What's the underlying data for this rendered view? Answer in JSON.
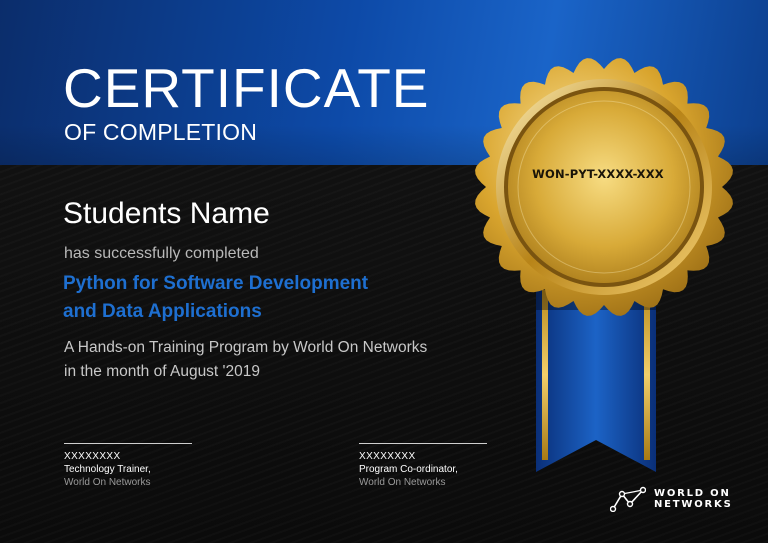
{
  "certificate": {
    "title": "CERTIFICATE",
    "subtitle": "OF COMPLETION",
    "student_name": "Students Name",
    "completed_text": "has successfully completed",
    "course_title_lines": [
      "Python for Software Development",
      "and Data Applications"
    ],
    "program_lines": [
      "A Hands-on Training Program by World On Networks",
      "in the month of August '2019"
    ]
  },
  "medal": {
    "certificate_id": "WON-PYT-XXXX-XXX"
  },
  "signatures": [
    {
      "name": "XXXXXXXX",
      "role": "Technology Trainer,",
      "org": "World On Networks"
    },
    {
      "name": "XXXXXXXX",
      "role": "Program Co-ordinator,",
      "org": "World On Networks"
    }
  ],
  "logo": {
    "lines": [
      "WORLD ON",
      "NETWORKS"
    ]
  },
  "colors": {
    "band_blue": "#0d4aa8",
    "course_blue": "#1e6fd0",
    "gold": "#d4a62a",
    "background": "#0e0e0e"
  }
}
